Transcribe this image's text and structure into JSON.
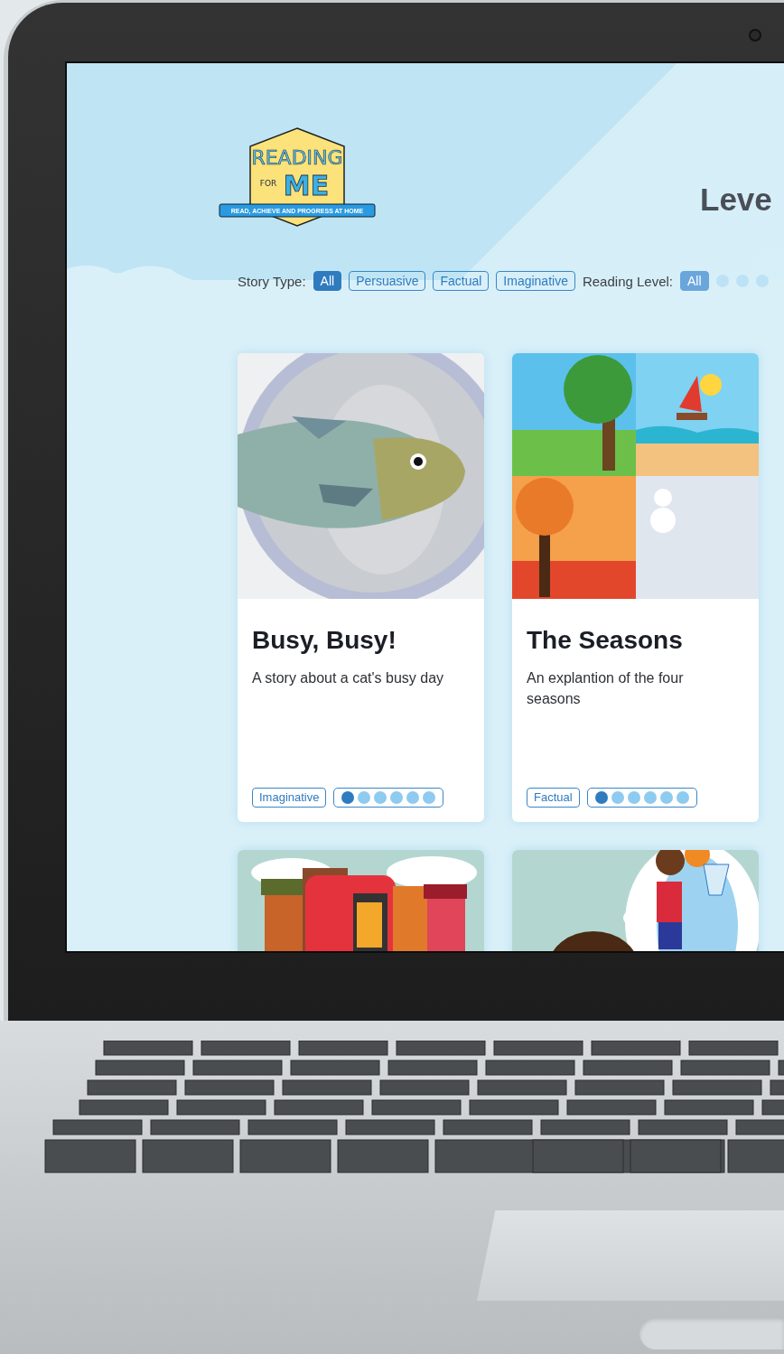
{
  "logo": {
    "line1": "READING",
    "line2": "FOR",
    "line3": "ME",
    "tagline": "READ, ACHIEVE AND PROGRESS AT HOME"
  },
  "heading": "Leve",
  "filters": {
    "story_type": {
      "label": "Story Type:",
      "options": [
        {
          "label": "All",
          "selected": true
        },
        {
          "label": "Persuasive",
          "selected": false
        },
        {
          "label": "Factual",
          "selected": false
        },
        {
          "label": "Imaginative",
          "selected": false
        }
      ]
    },
    "reading_level": {
      "label": "Reading Level:",
      "options": [
        {
          "label": "All",
          "selected": true
        }
      ],
      "dots": [
        {
          "selected": false
        },
        {
          "selected": false
        },
        {
          "selected": false
        }
      ]
    }
  },
  "cards": [
    {
      "kind": "full",
      "title": "Busy, Busy!",
      "description": "A story about a cat's busy day",
      "tag": "Imaginative",
      "level_dots": [
        {
          "selected": true
        },
        {
          "selected": false
        },
        {
          "selected": false
        },
        {
          "selected": false
        },
        {
          "selected": false
        },
        {
          "selected": false
        }
      ]
    },
    {
      "kind": "full",
      "title": "The Seasons",
      "description": "An explantion of the four seasons",
      "tag": "Factual",
      "level_dots": [
        {
          "selected": true
        },
        {
          "selected": false
        },
        {
          "selected": false
        },
        {
          "selected": false
        },
        {
          "selected": false
        },
        {
          "selected": false
        }
      ]
    },
    {
      "kind": "partial"
    },
    {
      "kind": "partial"
    }
  ]
}
